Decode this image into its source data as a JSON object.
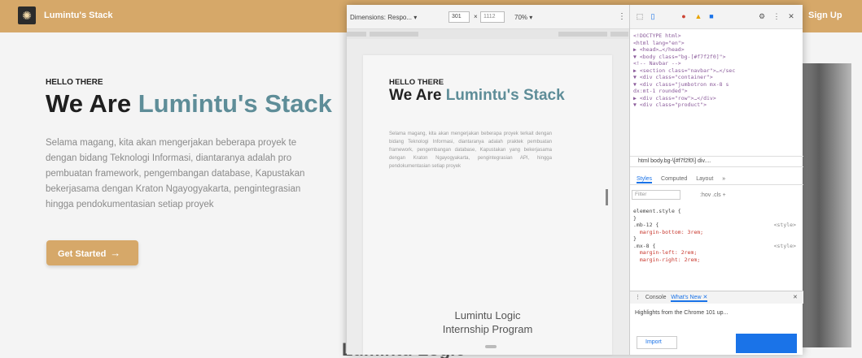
{
  "site": {
    "brand": "Lumintu's Stack",
    "signup": "Sign Up",
    "hero_eyebrow": "HELLO THERE",
    "hero_title_prefix": "We Are ",
    "hero_title_accent": "Lumintu's Stack",
    "hero_lines": [
      "Selama magang, kita akan mengerjakan beberapa proyek te",
      "dengan bidang Teknologi Informasi, diantaranya adalah pro",
      "pembuatan framework, pengembangan database, Kapustakan",
      "bekerjasama dengan Kraton Ngayogyakarta, pengintegrasian",
      "hingga pendokumentasian setiap proyek"
    ],
    "cta_label": "Get Started",
    "cta_icon": "arrow-right-icon",
    "bottom_peek": "Lumintu Logic"
  },
  "device": {
    "dimensions_label": "Dimensions: Respo...",
    "width": "301",
    "height": "1112",
    "zoom": "70%",
    "mobile": {
      "eyebrow": "HELLO THERE",
      "title_prefix": "We Are ",
      "title_accent": "Lumintu's Stack",
      "paragraph": "Selama magang, kita akan mengerjakan beberapa proyek terkait dengan bidang Teknologi Informasi, diantaranya adalah praktek pembuatan framework, pengembangan database, Kapustakan yang bekerjasama dengan Kraton Ngayogyakarta, pengintegrasian API, hingga pendokumentasian setiap proyek",
      "footer_line1": "Lumintu Logic",
      "footer_line2": "Internship Program"
    }
  },
  "devtools": {
    "dom_lines": [
      "<!DOCTYPE html>",
      "<html lang=\"en\">",
      "▶ <head>…</head>",
      "▼ <body class=\"bg-[#f7f2f0]\">",
      "    <!-- Navbar -->",
      "  ▶ <section class=\"navbar\">…</sec",
      "  ▼ <div class=\"container\">",
      "    ▼ <div class=\"jumbotron mx-8 s",
      "        dx:mt-1 rounded\">",
      "      ▶ <div class=\"row\">…</div>",
      "      ▼ <div class=\"product\">"
    ],
    "breadcrumb": "html  body.bg-\\[#f7f2f0\\]  div....",
    "style_tabs": [
      "Styles",
      "Computed",
      "Layout",
      "»"
    ],
    "filter_placeholder": "Filter",
    "filter_right": ":hov  .cls  +",
    "css_rules": [
      {
        "selector": "element.style {",
        "prop": "",
        "src": ""
      },
      {
        "selector": "}",
        "prop": "",
        "src": ""
      },
      {
        "selector": ".mb-12 {",
        "prop": "",
        "src": "<style>"
      },
      {
        "selector": "",
        "prop": "margin-bottom: 3rem;",
        "src": ""
      },
      {
        "selector": "}",
        "prop": "",
        "src": ""
      },
      {
        "selector": ".mx-8 {",
        "prop": "",
        "src": "<style>"
      },
      {
        "selector": "",
        "prop": "margin-left: 2rem;",
        "src": ""
      },
      {
        "selector": "",
        "prop": "margin-right: 2rem;",
        "src": ""
      }
    ],
    "console_tab": "Console",
    "whats_new_tab": "What's New",
    "whats_new_text": "Highlights from the Chrome 101 up...",
    "import_label": "Import"
  }
}
